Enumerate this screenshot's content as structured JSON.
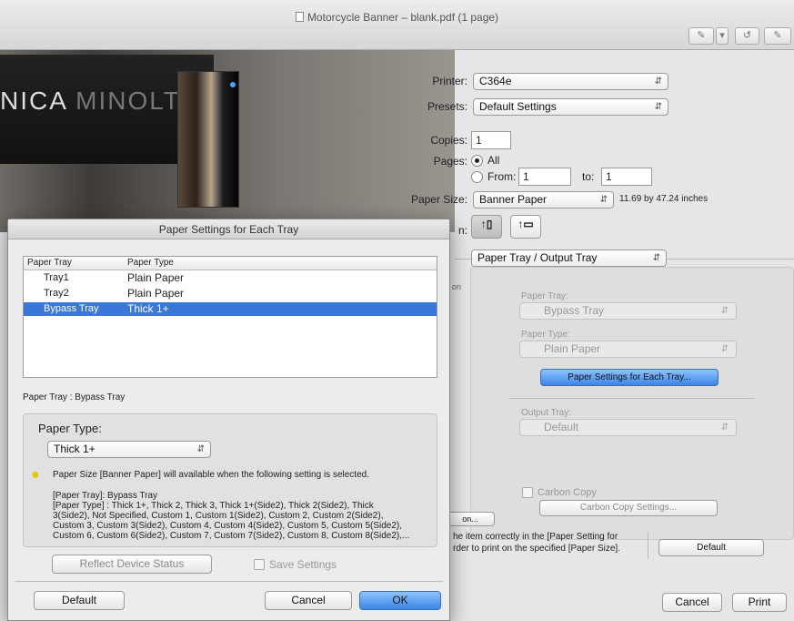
{
  "window": {
    "title": "Motorcycle Banner – blank.pdf (1 page)"
  },
  "preview": {
    "brand_left": "NICA ",
    "brand_right": "MINOLTA"
  },
  "print": {
    "printer_label": "Printer:",
    "printer_value": "C364e",
    "presets_label": "Presets:",
    "presets_value": "Default Settings",
    "copies_label": "Copies:",
    "copies_value": "1",
    "pages_label": "Pages:",
    "pages_all": "All",
    "pages_from": "From:",
    "from_value": "1",
    "to_label": "to:",
    "to_value": "1",
    "paper_size_label": "Paper Size:",
    "paper_size_value": "Banner Paper",
    "paper_size_dims": "11.69 by 47.24 inches",
    "orientation_label": "n:",
    "section_value": "Paper Tray / Output Tray"
  },
  "right_pane": {
    "paper_tray_label": "Paper Tray:",
    "paper_tray_value": "Bypass Tray",
    "paper_type_label": "Paper Type:",
    "paper_type_value": "Plain Paper",
    "settings_button": "Paper Settings for Each Tray...",
    "output_tray_label": "Output Tray:",
    "output_tray_value": "Default",
    "carbon_copy_label": "Carbon Copy",
    "carbon_copy_button": "Carbon Copy Settings...",
    "partial_left": "on",
    "partial_left2": "on...",
    "footer_note_1": "he item correctly in the [Paper Setting for",
    "footer_note_2": "rder to print on the specified [Paper Size].",
    "default_button": "Default",
    "cancel_button": "Cancel",
    "print_button": "Print"
  },
  "modal": {
    "title": "Paper Settings for Each Tray",
    "col_tray": "Paper Tray",
    "col_type": "Paper Type",
    "rows": [
      {
        "tray": "Tray1",
        "type": "Plain Paper"
      },
      {
        "tray": "Tray2",
        "type": "Plain Paper"
      },
      {
        "tray": "Bypass Tray",
        "type": "Thick 1+"
      }
    ],
    "selection_label": "Paper Tray : Bypass Tray",
    "paper_type_label": "Paper Type:",
    "paper_type_value": "Thick 1+",
    "warning": "Paper Size [Banner Paper] will available when the following setting is selected.",
    "detail_1": "[Paper Tray]: Bypass Tray",
    "detail_2": "[Paper Type] : Thick 1+, Thick 2, Thick 3, Thick 1+(Side2), Thick 2(Side2), Thick",
    "detail_3": "3(Side2), Not Specified, Custom 1, Custom 1(Side2), Custom 2, Custom 2(Side2),",
    "detail_4": "Custom 3, Custom 3(Side2), Custom 4, Custom 4(Side2), Custom 5, Custom 5(Side2),",
    "detail_5": "Custom 6, Custom 6(Side2), Custom 7, Custom 7(Side2), Custom 8, Custom 8(Side2),...",
    "reflect_button": "Reflect Device Status",
    "save_settings": "Save Settings",
    "default_button": "Default",
    "cancel_button": "Cancel",
    "ok_button": "OK"
  }
}
